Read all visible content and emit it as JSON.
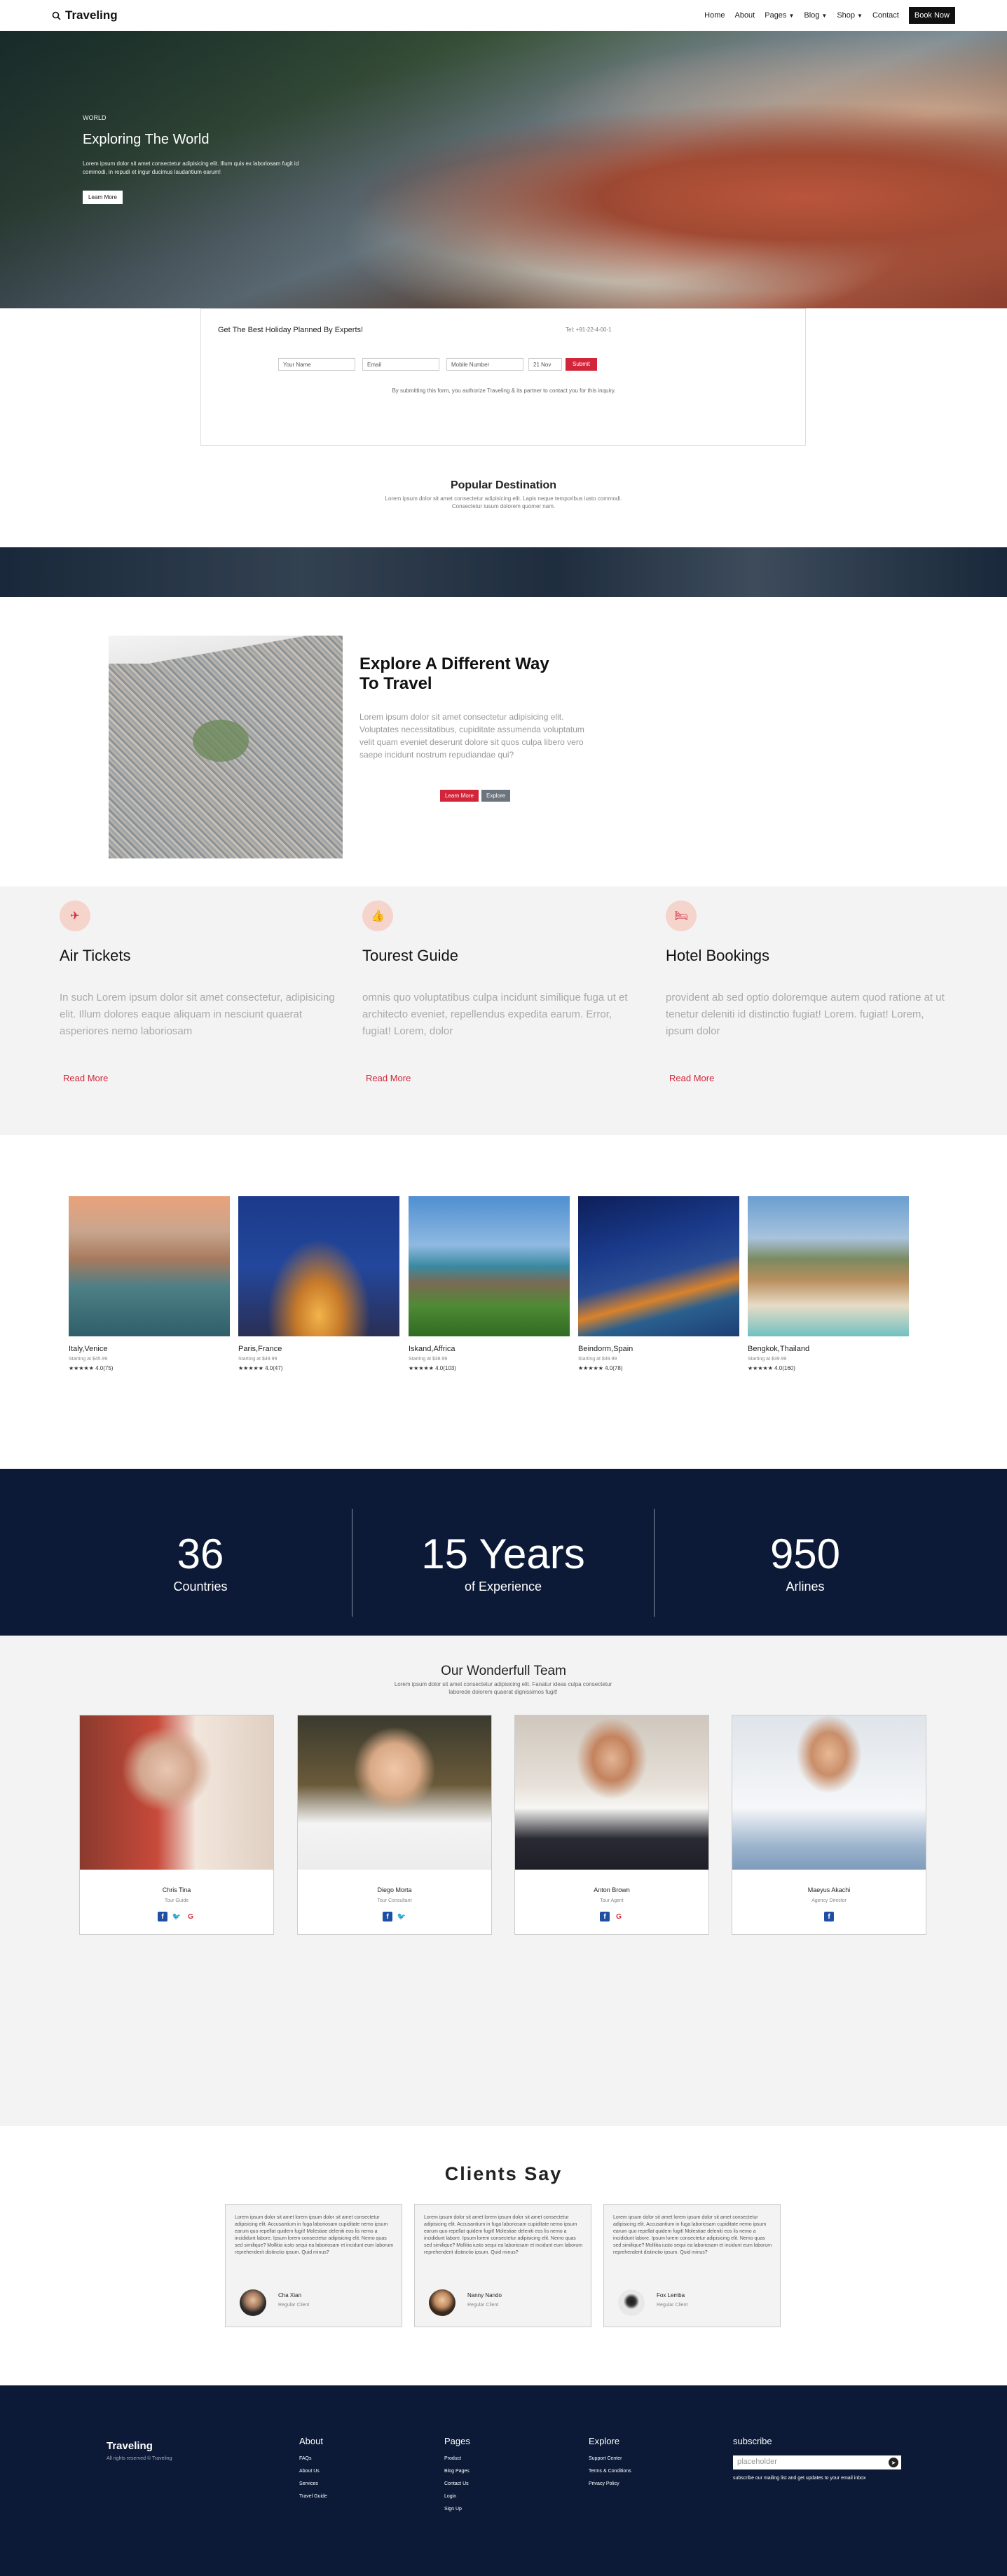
{
  "nav": {
    "brand": "Traveling",
    "items": [
      "Home",
      "About",
      "Pages",
      "Blog",
      "Shop",
      "Contact"
    ],
    "book": "Book Now"
  },
  "hero": {
    "pre": "WORLD",
    "title": "Exploring The World",
    "text": "Lorem ipsum dolor sit amet consectetur adipisicing elit. Illum quis ex laboriosam fugit id commodi, in repudi et ingur ducimus laudantium earum!",
    "btn": "Learn More"
  },
  "form": {
    "title": "Get The Best Holiday Planned By Experts!",
    "call": "Tel: +91-22-4-00-1",
    "name": "Your Name",
    "email": "Email",
    "mobile": "Mobile Number",
    "date": "21 Nov",
    "submit": "Submit",
    "note": "By submitting this form, you authorize Traveling & its partner to contact you for this inquiry."
  },
  "popular": {
    "title": "Popular Destination",
    "text": "Lorem ipsum dolor sit amet consectetur adipisicing elit. Lapis neque temporibus iusto commodi. Consectetur iusum dolorem quomer nam."
  },
  "explore": {
    "title": "Explore A Different Way To Travel",
    "text": "Lorem ipsum dolor sit amet consectetur adipisicing elit. Voluptates necessitatibus, cupiditate assumenda voluptatum velit quam eveniet deserunt dolore sit quos culpa libero vero saepe incidunt nostrum repudiandae qui?",
    "b1": "Learn More",
    "b2": "Explore"
  },
  "services": [
    {
      "icon": "✈",
      "title": "Air Tickets",
      "text": "In such Lorem ipsum dolor sit amet consectetur, adipisicing elit. Illum dolores eaque aliquam in nesciunt quaerat asperiores nemo laboriosam",
      "link": "Read More"
    },
    {
      "icon": "👍",
      "title": "Tourest Guide",
      "text": "omnis quo voluptatibus culpa incidunt similique fuga ut et architecto eveniet, repellendus expedita earum. Error, fugiat! Lorem, dolor",
      "link": "Read More"
    },
    {
      "icon": "🛏",
      "title": "Hotel Bookings",
      "text": "provident ab sed optio doloremque autem quod ratione at ut tenetur deleniti id distinctio fugiat! Lorem. fugiat! Lorem, ipsum dolor",
      "link": "Read More"
    }
  ],
  "destinations": [
    {
      "name": "Italy,Venice",
      "start": "Starting at $45.99",
      "rating": "★★★★★ 4.0(75)"
    },
    {
      "name": "Paris,France",
      "start": "Starting at $49.99",
      "rating": "★★★★★ 4.0(47)"
    },
    {
      "name": "Iskand,Affrica",
      "start": "Starting at $38.99",
      "rating": "★★★★★ 4.0(103)"
    },
    {
      "name": "Beindorm,Spain",
      "start": "Starting at $39.99",
      "rating": "★★★★★ 4.0(78)"
    },
    {
      "name": "Bengkok,Thailand",
      "start": "Starting at $39.99",
      "rating": "★★★★★ 4.0(160)"
    }
  ],
  "stats": [
    {
      "n": "36",
      "l": "Countries"
    },
    {
      "n": "15 Years",
      "l": "of Experience"
    },
    {
      "n": "950",
      "l": "Arlines"
    }
  ],
  "team": {
    "title": "Our Wonderfull Team",
    "text": "Lorem ipsum dolor sit amet consectetur adipisicing elit. Fanatur ideas culpa consectetur laborede dolorem quaerat dignissimos fugit!",
    "members": [
      {
        "name": "Chris Tina",
        "role": "Tour Guide"
      },
      {
        "name": "Diego Morta",
        "role": "Tour Consultant"
      },
      {
        "name": "Anton Brown",
        "role": "Tour Agent"
      },
      {
        "name": "Maeyus Akachi",
        "role": "Agency Director"
      }
    ]
  },
  "clients": {
    "title": "Clients Say",
    "quote": "Lorem ipsum dolor sit amet lorem ipsum dolor sit amet consectetur adipisicing elit. Accusantium in fuga laboriosam cupiditate nemo ipsum earum quo repellat quidem fugit! Molestiae deleniti eos lis nemo a incididunt labore. Ipsum lorem consectetur adipisicing elit. Nemo quas sed similique? Mollitia iusto sequi ea laboriosam et incidunt eum laborum reprehenderit distinctio ipsum. Quid minus?",
    "people": [
      {
        "name": "Cha Xian",
        "role": "Regular Client"
      },
      {
        "name": "Nanny Nando",
        "role": "Regular Client"
      },
      {
        "name": "Fox Lemba",
        "role": "Regular Client"
      }
    ]
  },
  "footer": {
    "brand": "Traveling",
    "copy": "All rights reserved © Traveling",
    "cols": [
      {
        "title": "About",
        "items": [
          "FAQs",
          "About Us",
          "Services",
          "Travel Guide"
        ]
      },
      {
        "title": "Pages",
        "items": [
          "Product",
          "Blog Pages",
          "Contact Us",
          "Login",
          "Sign Up"
        ]
      },
      {
        "title": "Explore",
        "items": [
          "Support Center",
          "Terms & Conditions",
          "Privacy Policy"
        ]
      }
    ],
    "sub": {
      "title": "subscribe",
      "placeholder": "placeholder",
      "note": "subscribe our mailing list and get updates to your email inbox"
    }
  }
}
